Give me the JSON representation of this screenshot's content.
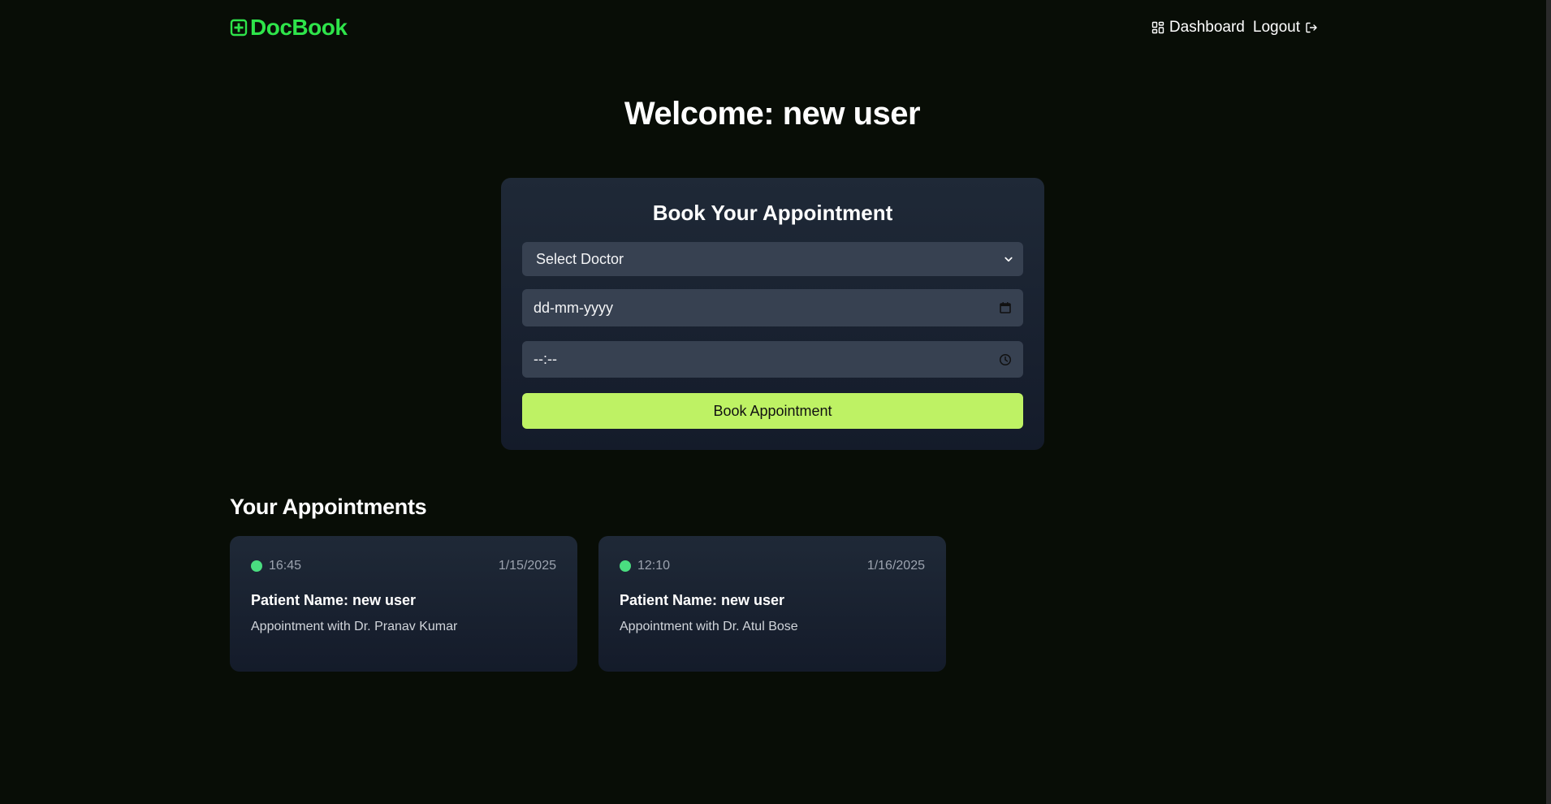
{
  "header": {
    "brand": "DocBook",
    "brand_color": "#2ee44a",
    "nav": [
      {
        "label": "Dashboard",
        "icon": "grid-icon"
      },
      {
        "label": "Logout",
        "icon": "logout-icon"
      }
    ]
  },
  "welcome": "Welcome: new user",
  "booking": {
    "title": "Book Your Appointment",
    "doctor_select": {
      "value": "Select Doctor",
      "icon": "chevron-down-icon"
    },
    "date_input": {
      "placeholder": "dd-mm-yyyy",
      "icon": "calendar-icon"
    },
    "time_input": {
      "placeholder": "--:--",
      "icon": "clock-icon"
    },
    "submit_label": "Book Appointment",
    "accent": "#bef264"
  },
  "appointments": {
    "title": "Your Appointments",
    "items": [
      {
        "time": "16:45",
        "date": "1/15/2025",
        "patient": "Patient Name: new user",
        "doctor": "Appointment with Dr. Pranav Kumar",
        "status_color": "#4ade80"
      },
      {
        "time": "12:10",
        "date": "1/16/2025",
        "patient": "Patient Name: new user",
        "doctor": "Appointment with Dr. Atul Bose",
        "status_color": "#4ade80"
      }
    ]
  }
}
